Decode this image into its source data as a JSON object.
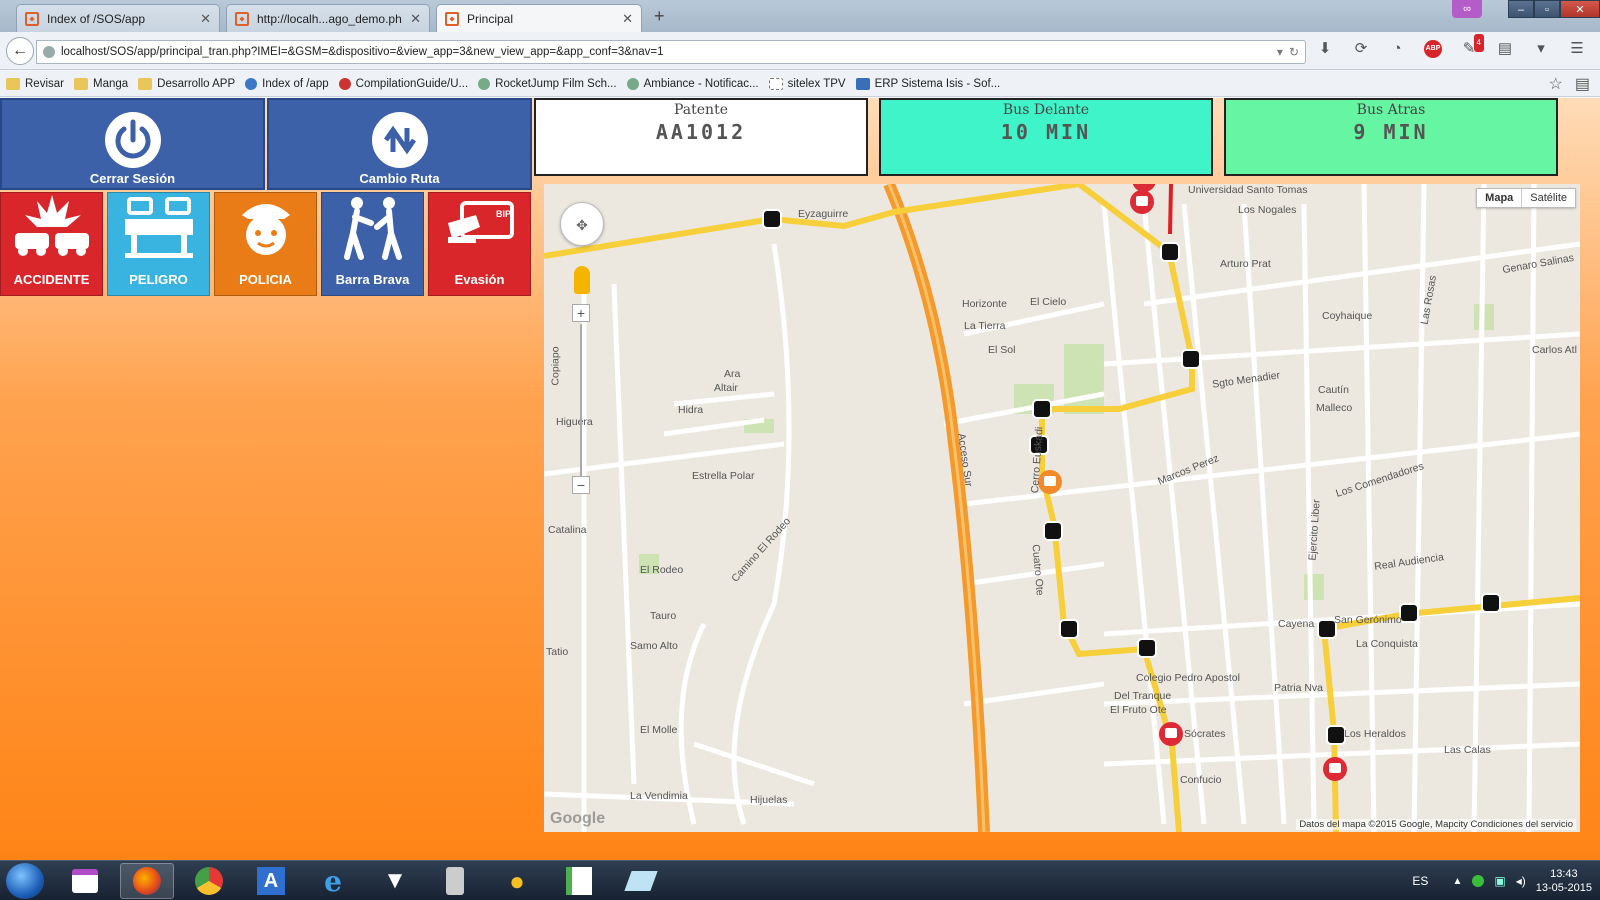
{
  "browser": {
    "tabs": [
      {
        "label": "Index of /SOS/app",
        "active": false
      },
      {
        "label": "http://localh...ago_demo.php",
        "active": false
      },
      {
        "label": "Principal",
        "active": true
      }
    ],
    "new_tab": "+",
    "url": "localhost/SOS/app/principal_tran.php?IMEI=&GSM=&dispositivo=&view_app=3&new_view_app=&app_conf=3&nav=1",
    "abp_badge": "ABP",
    "notify_count": "4",
    "bookmarks": [
      {
        "label": "Revisar",
        "icon": "folder"
      },
      {
        "label": "Manga",
        "icon": "folder"
      },
      {
        "label": "Desarrollo APP",
        "icon": "folder"
      },
      {
        "label": "Index of /app",
        "icon": "site"
      },
      {
        "label": "CompilationGuide/U...",
        "icon": "ext"
      },
      {
        "label": "RocketJump Film Sch...",
        "icon": "globeg"
      },
      {
        "label": "Ambiance - Notificac...",
        "icon": "globeg"
      },
      {
        "label": "sitelex TPV",
        "icon": "plain"
      },
      {
        "label": "ERP Sistema Isis - Sof...",
        "icon": "erp"
      }
    ]
  },
  "panel": {
    "logout_label": "Cerrar Sesión",
    "route_label": "Cambio Ruta",
    "alerts": [
      {
        "label": "ACCIDENTE",
        "color": "#d8262b",
        "icon": "car-crash-icon"
      },
      {
        "label": "PELIGRO",
        "color": "#39b4e0",
        "icon": "barrier-icon"
      },
      {
        "label": "POLICIA",
        "color": "#ea7c17",
        "icon": "police-icon"
      },
      {
        "label": "Barra Brava",
        "color": "#3c61a8",
        "icon": "fight-icon"
      },
      {
        "label": "Evasión",
        "color": "#d8262b",
        "icon": "fare-card-icon"
      }
    ]
  },
  "info": {
    "patente_title": "Patente",
    "patente_value": "AA1012",
    "ahead_title": "Bus Delante",
    "ahead_value": "10 MIN",
    "ahead_color": "#3ff4c8",
    "behind_title": "Bus Atras",
    "behind_value": "9 MIN",
    "behind_color": "#66f5a2"
  },
  "map": {
    "type_map": "Mapa",
    "type_sat": "Satélite",
    "zoom_in": "+",
    "zoom_out": "−",
    "logo": "Google",
    "footer": "Datos del mapa ©2015 Google, Mapcity    Condiciones del servicio",
    "streets": [
      "Eyzaguirre",
      "Universidad Santo Tomas",
      "Los Nogales",
      "Arturo Prat",
      "Sgto Menadier",
      "Hidra",
      "Ara",
      "Altair",
      "Higuera",
      "Estrella Polar",
      "El Rodeo",
      "Camino El Rodeo",
      "Tauro",
      "Samo Alto",
      "Hijuelas",
      "Acceso Sur",
      "Cuatro Ote",
      "Colegio Pedro Apostol",
      "Los Comendadores",
      "Real Audiencia",
      "La Conquista",
      "Los Heraldos",
      "Las Calas",
      "San Gerónimo",
      "Ejercito Liber",
      "Cerro Euskadi",
      "Marcos Perez",
      "Genaro Salinas",
      "Coyhaique",
      "La Vendimia",
      "Catalina",
      "El Molle",
      "Patria Nva",
      "Confucio",
      "Sócrates",
      "Del Tranque",
      "El Fruto Ote",
      "Cayena",
      "Las Rosas",
      "Carlos Atl",
      "Malleco",
      "Cautín",
      "Horizonte",
      "El Cielo",
      "La Tierra",
      "El Sol",
      "Tatio",
      "Copiapo"
    ]
  },
  "taskbar": {
    "lang": "ES",
    "time": "13:43",
    "date": "13-05-2015"
  }
}
